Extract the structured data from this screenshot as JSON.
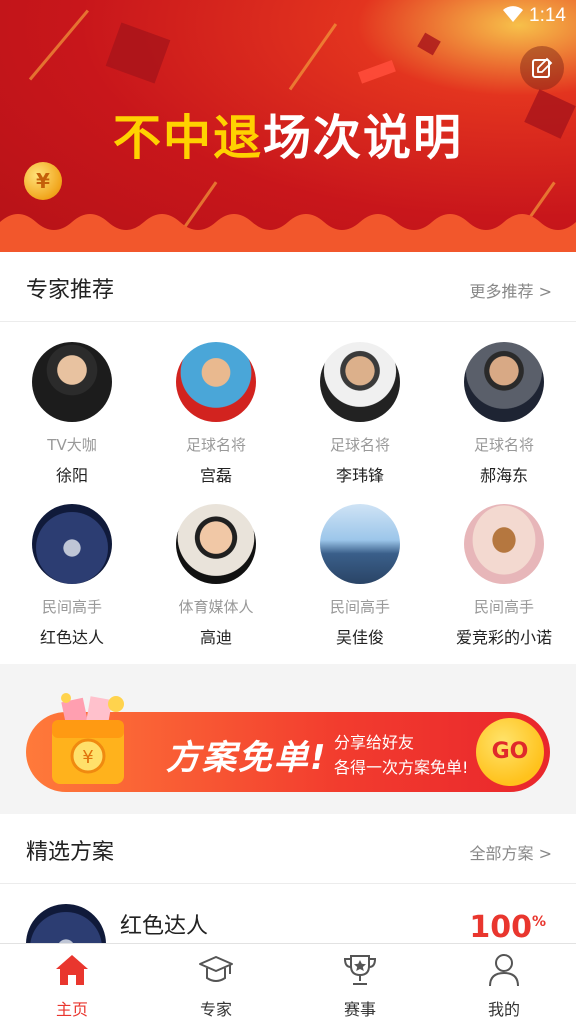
{
  "status_bar": {
    "time": "1:14"
  },
  "banner": {
    "title_highlight": "不中退",
    "title_rest": "场次说明",
    "coin_symbol": "¥"
  },
  "experts_section": {
    "title": "专家推荐",
    "more": "更多推荐 >",
    "items": [
      {
        "tag": "TV大咖",
        "name": "徐阳"
      },
      {
        "tag": "足球名将",
        "name": "宫磊"
      },
      {
        "tag": "足球名将",
        "name": "李玮锋"
      },
      {
        "tag": "足球名将",
        "name": "郝海东"
      },
      {
        "tag": "民间高手",
        "name": "红色达人"
      },
      {
        "tag": "体育媒体人",
        "name": "高迪"
      },
      {
        "tag": "民间高手",
        "name": "吴佳俊"
      },
      {
        "tag": "民间高手",
        "name": "爱竞彩的小诺"
      }
    ]
  },
  "promo": {
    "main": "方案免单!",
    "sub1": "分享给好友",
    "sub2": "各得一次方案免单!",
    "go": "GO"
  },
  "plans_section": {
    "title": "精选方案",
    "more": "全部方案 >",
    "first": {
      "name": "红色达人",
      "rate": "100",
      "rate_unit": "%"
    }
  },
  "tabs": [
    {
      "label": "主页",
      "icon": "home-icon",
      "active": true
    },
    {
      "label": "专家",
      "icon": "graduation-cap-icon",
      "active": false
    },
    {
      "label": "赛事",
      "icon": "trophy-icon",
      "active": false
    },
    {
      "label": "我的",
      "icon": "person-icon",
      "active": false
    }
  ],
  "colors": {
    "accent": "#e9362e",
    "banner_red": "#c8161b",
    "highlight_yellow": "#ffd200"
  }
}
